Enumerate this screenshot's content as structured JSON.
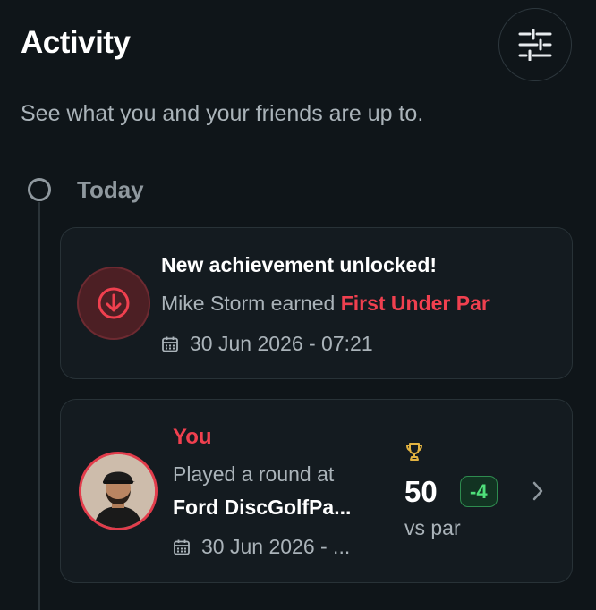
{
  "header": {
    "title": "Activity",
    "filter_icon": "sliders-icon"
  },
  "subtitle": "See what you and your friends are up to.",
  "timeline": {
    "group_label": "Today"
  },
  "achievement_card": {
    "icon": "arrow-down-circle-icon",
    "title": "New achievement unlocked!",
    "player": "Mike Storm earned",
    "achievement": "First Under Par",
    "date": "30 Jun 2026 - 07:21"
  },
  "round_card": {
    "actor": "You",
    "action": "Played a round at",
    "course": "Ford DiscGolfPa...",
    "date": "30 Jun 2026 - ...",
    "score": "50",
    "par_diff": "-4",
    "score_label": "vs par",
    "trophy_icon": "trophy-icon",
    "chevron_icon": "chevron-right-icon"
  },
  "colors": {
    "background": "#0f1519",
    "accent_red": "#f0404f",
    "accent_green": "#4fe07a",
    "trophy_gold": "#e2b341"
  }
}
